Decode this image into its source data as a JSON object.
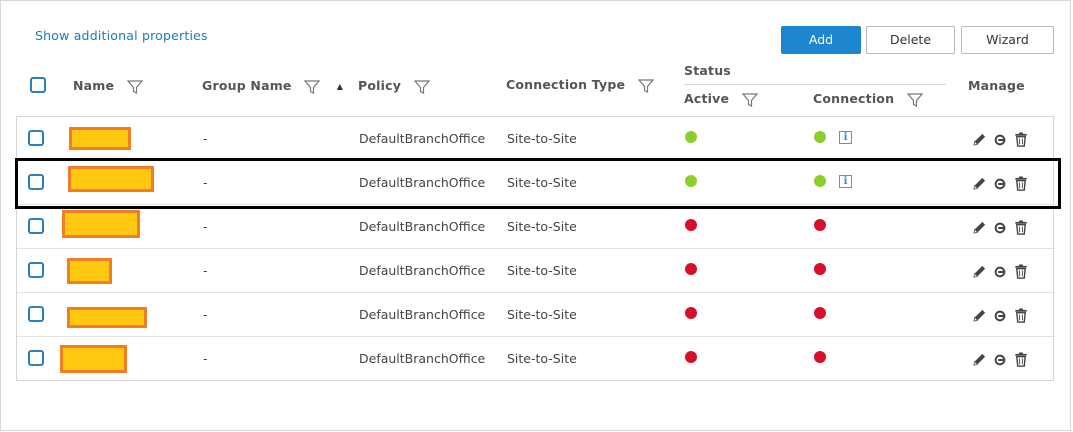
{
  "toolbar": {
    "show_additional": "Show additional properties",
    "add_label": "Add",
    "delete_label": "Delete",
    "wizard_label": "Wizard"
  },
  "headers": {
    "name": "Name",
    "group_name": "Group Name",
    "policy": "Policy",
    "connection_type": "Connection Type",
    "status": "Status",
    "active": "Active",
    "connection": "Connection",
    "manage": "Manage"
  },
  "rows": [
    {
      "group": "-",
      "policy": "DefaultBranchOffice",
      "type": "Site-to-Site",
      "active": "green",
      "connection": "green",
      "info": "i"
    },
    {
      "group": "-",
      "policy": "DefaultBranchOffice",
      "type": "Site-to-Site",
      "active": "green",
      "connection": "green",
      "info": "i"
    },
    {
      "group": "-",
      "policy": "DefaultBranchOffice",
      "type": "Site-to-Site",
      "active": "red",
      "connection": "red"
    },
    {
      "group": "-",
      "policy": "DefaultBranchOffice",
      "type": "Site-to-Site",
      "active": "red",
      "connection": "red"
    },
    {
      "group": "-",
      "policy": "DefaultBranchOffice",
      "type": "Site-to-Site",
      "active": "red",
      "connection": "red"
    },
    {
      "group": "-",
      "policy": "DefaultBranchOffice",
      "type": "Site-to-Site",
      "active": "red",
      "connection": "red"
    }
  ],
  "colors": {
    "accent": "#1e86d0",
    "status_green": "#8ccf2c",
    "status_red": "#d6102a",
    "redaction_fill": "#ffc70f",
    "redaction_border": "#f07e27"
  },
  "icons": {
    "filter": "filter-funnel-icon",
    "sort": "sort-ascending-icon",
    "edit": "pencil-icon",
    "link": "link-icon",
    "delete": "trash-icon",
    "info": "info-icon"
  }
}
